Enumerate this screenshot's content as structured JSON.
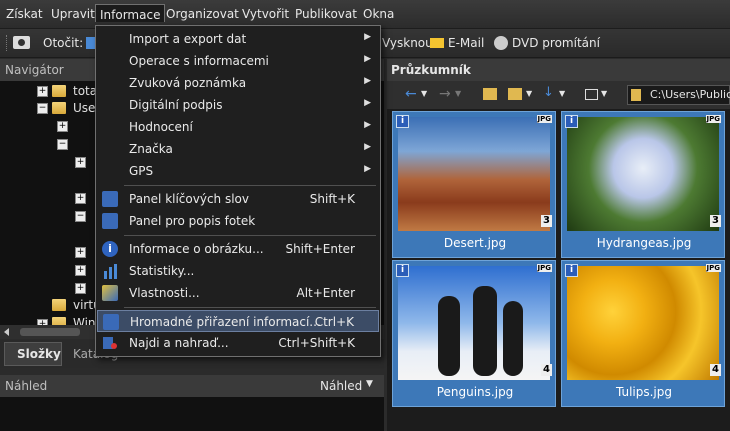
{
  "menubar": {
    "items": [
      "Získat",
      "Upravit",
      "Informace",
      "Organizovat",
      "Vytvořit",
      "Publikovat",
      "Okna"
    ]
  },
  "toolbar": {
    "rotate_label": "Otočit:",
    "skenout": "Vysknout",
    "email": "E-Mail",
    "dvd": "DVD promítání"
  },
  "navigator": {
    "title": "Navigátor",
    "tree": [
      "tota",
      "User",
      "virtu",
      "Win"
    ],
    "tabs": [
      "Složky",
      "Katalog"
    ]
  },
  "nahled": {
    "title": "Náhled",
    "dropdown": "Náhled"
  },
  "explorer": {
    "title": "Průzkumník",
    "path": "C:\\Users\\Public\\P",
    "thumbnails": [
      {
        "name": "Desert.jpg",
        "count": "3",
        "badge": "JPG"
      },
      {
        "name": "Hydrangeas.jpg",
        "count": "3",
        "badge": "JPG"
      },
      {
        "name": "Penguins.jpg",
        "count": "4",
        "badge": "JPG"
      },
      {
        "name": "Tulips.jpg",
        "count": "4",
        "badge": "JPG"
      }
    ]
  },
  "menu": {
    "items": [
      {
        "label": "Import a export dat",
        "shortcut": "",
        "submenu": true
      },
      {
        "label": "Operace s informacemi",
        "shortcut": "",
        "submenu": true
      },
      {
        "label": "Zvuková poznámka",
        "shortcut": "",
        "submenu": true
      },
      {
        "label": "Digitální podpis",
        "shortcut": "",
        "submenu": true
      },
      {
        "label": "Hodnocení",
        "shortcut": "",
        "submenu": true
      },
      {
        "label": "Značka",
        "shortcut": "",
        "submenu": true
      },
      {
        "label": "GPS",
        "shortcut": "",
        "submenu": true
      },
      {
        "label": "Panel klíčových slov",
        "shortcut": "Shift+K",
        "submenu": false
      },
      {
        "label": "Panel pro popis fotek",
        "shortcut": "",
        "submenu": false
      },
      {
        "label": "Informace o obrázku...",
        "shortcut": "Shift+Enter",
        "submenu": false
      },
      {
        "label": "Statistiky...",
        "shortcut": "",
        "submenu": false
      },
      {
        "label": "Vlastnosti...",
        "shortcut": "Alt+Enter",
        "submenu": false
      },
      {
        "label": "Hromadné přiřazení informací...",
        "shortcut": "Ctrl+K",
        "submenu": false
      },
      {
        "label": "Najdi a nahraď...",
        "shortcut": "Ctrl+Shift+K",
        "submenu": false
      }
    ]
  }
}
